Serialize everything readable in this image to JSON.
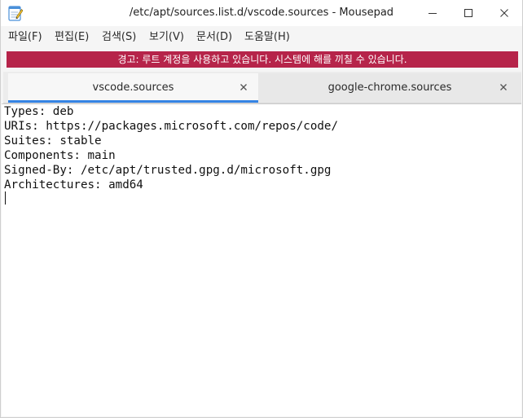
{
  "window": {
    "title": "/etc/apt/sources.list.d/vscode.sources - Mousepad",
    "app_icon": "mousepad-notepad-icon"
  },
  "controls": {
    "minimize_icon": "minimize-icon",
    "maximize_icon": "maximize-icon",
    "close_icon": "close-icon"
  },
  "menu": {
    "items": [
      {
        "label": "파일(F)"
      },
      {
        "label": "편집(E)"
      },
      {
        "label": "검색(S)"
      },
      {
        "label": "보기(V)"
      },
      {
        "label": "문서(D)"
      },
      {
        "label": "도움말(H)"
      }
    ]
  },
  "warning": {
    "text": "경고: 루트 계정을 사용하고 있습니다. 시스템에 해를 끼칠 수 있습니다.",
    "color": "#b6244a"
  },
  "tabs": [
    {
      "label": "vscode.sources",
      "active": true
    },
    {
      "label": "google-chrome.sources",
      "active": false
    }
  ],
  "editor": {
    "lines": [
      "Types: deb",
      "URIs: https://packages.microsoft.com/repos/code/",
      "Suites: stable",
      "Components: main",
      "Signed-By: /etc/apt/trusted.gpg.d/microsoft.gpg",
      "Architectures: amd64"
    ]
  },
  "colors": {
    "accent": "#3584e4",
    "warning_bg": "#b6244a"
  }
}
